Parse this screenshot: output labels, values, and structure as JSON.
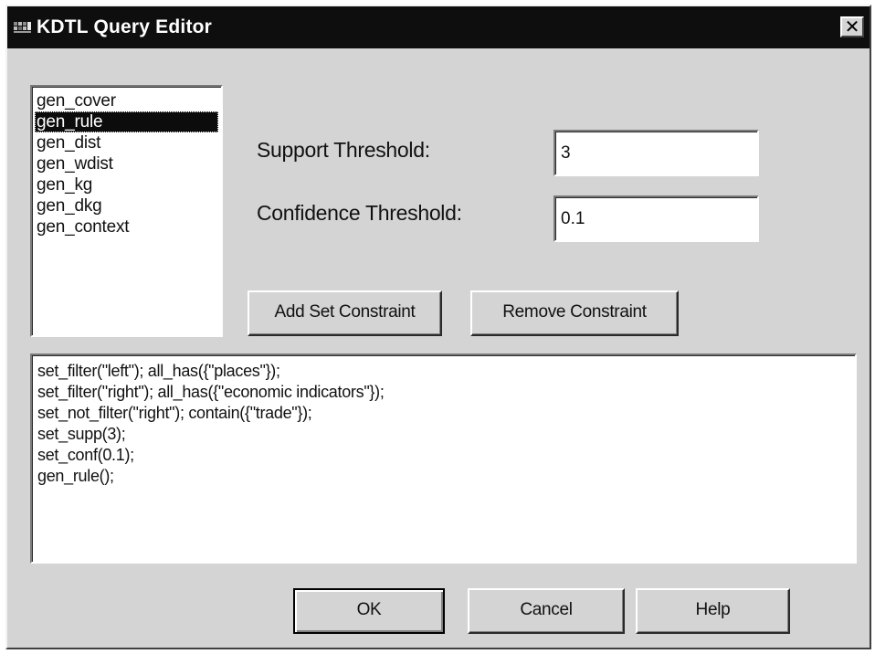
{
  "window": {
    "title": "KDTL Query Editor",
    "close_glyph": "✕"
  },
  "query_types": {
    "items": [
      "gen_cover",
      "gen_rule",
      "gen_dist",
      "gen_wdist",
      "gen_kg",
      "gen_dkg",
      "gen_context"
    ],
    "selected": "gen_rule"
  },
  "support": {
    "label": "Support Threshold:",
    "value": "3"
  },
  "confidence": {
    "label": "Confidence Threshold:",
    "value": "0.1"
  },
  "buttons": {
    "add_constraint": "Add Set Constraint",
    "remove_constraint": "Remove Constraint",
    "ok": "OK",
    "cancel": "Cancel",
    "help": "Help"
  },
  "query": {
    "lines": [
      "set_filter(\"left\"); all_has({\"places\"});",
      "set_filter(\"right\"); all_has({\"economic indicators\"});",
      "set_not_filter(\"right\"); contain({\"trade\"});",
      "set_supp(3);",
      "set_conf(0.1);",
      "gen_rule();"
    ]
  },
  "colors": {
    "titlebar": "#0e0e0e",
    "dialog_face": "#d4d4d4",
    "selection": "#0c0c0c"
  },
  "icons": {
    "app": "app-icon",
    "close": "close-icon"
  }
}
